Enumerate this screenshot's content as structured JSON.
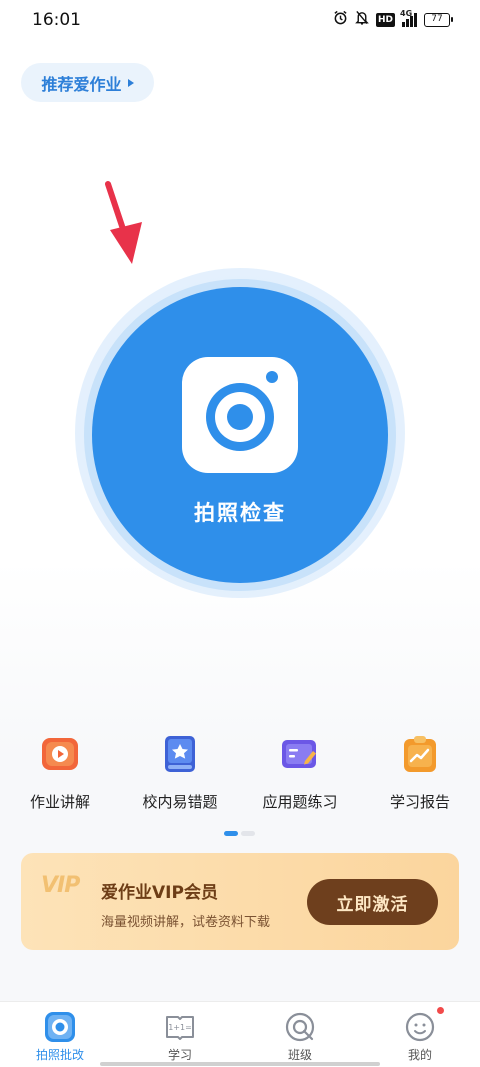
{
  "status_bar": {
    "time": "16:01",
    "hd": "HD",
    "network": "4G",
    "battery": "77"
  },
  "recommend": {
    "label": "推荐爱作业"
  },
  "camera": {
    "label": "拍照检查"
  },
  "features": [
    {
      "label": "作业讲解",
      "icon": "play-video-icon",
      "color": "#f2663a"
    },
    {
      "label": "校内易错题",
      "icon": "star-book-icon",
      "color": "#3e62d6"
    },
    {
      "label": "应用题练习",
      "icon": "pencil-card-icon",
      "color": "#6b57e6"
    },
    {
      "label": "学习报告",
      "icon": "clipboard-chart-icon",
      "color": "#f39a2c"
    }
  ],
  "pager": {
    "pages": 2,
    "active": 0
  },
  "vip": {
    "logo": "VIP",
    "title": "爱作业VIP会员",
    "subtitle": "海量视频讲解，试卷资料下载",
    "button": "立即激活"
  },
  "tabs": [
    {
      "label": "拍照批改",
      "icon": "camera-scan-icon",
      "active": true
    },
    {
      "label": "学习",
      "icon": "book-math-icon",
      "active": false
    },
    {
      "label": "班级",
      "icon": "search-circle-icon",
      "active": false
    },
    {
      "label": "我的",
      "icon": "profile-icon",
      "active": false
    }
  ],
  "colors": {
    "primary": "#2f8fea",
    "accent_red": "#e8324a",
    "vip_brown": "#6e3f1d"
  }
}
